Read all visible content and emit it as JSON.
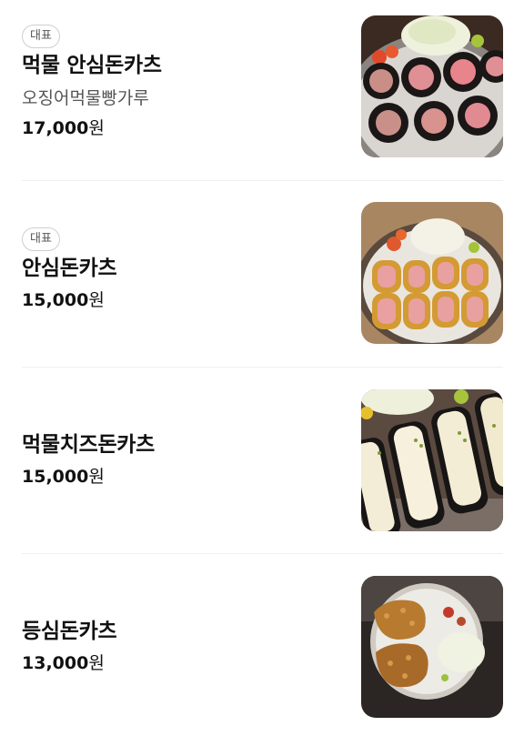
{
  "menu_items": [
    {
      "badge": "대표",
      "name": "먹물 안심돈카츠",
      "description": "오징어먹물빵가루",
      "price": "17,000",
      "currency": "원"
    },
    {
      "badge": "대표",
      "name": "안심돈카츠",
      "price": "15,000",
      "currency": "원"
    },
    {
      "name": "먹물치즈돈카츠",
      "price": "15,000",
      "currency": "원"
    },
    {
      "name": "등심돈카츠",
      "price": "13,000",
      "currency": "원"
    }
  ]
}
